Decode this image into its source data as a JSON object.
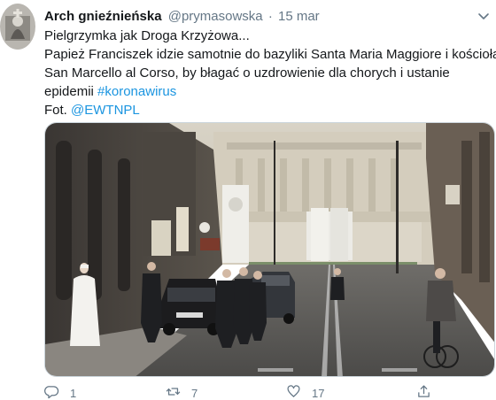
{
  "author": {
    "display_name": "Arch gnieźnieńska",
    "handle": "@prymasowska",
    "separator": "·",
    "timestamp": "15 mar"
  },
  "tweet": {
    "line1": "Pielgrzymka jak Droga Krzyżowa...",
    "line2": "Papież Franciszek idzie samotnie do bazyliki Santa Maria Maggiore i kościoła",
    "line3": "San Marcello al Corso, by błagać o uzdrowienie dla chorych i ustanie",
    "line4_text": "epidemii ",
    "hashtag": "#koronawirus",
    "line5_text": "Fot. ",
    "mention": "@EWTNPL"
  },
  "actions": {
    "reply_count": "1",
    "retweet_count": "7",
    "like_count": "17"
  },
  "icons": {
    "reply": "reply-icon",
    "retweet": "retweet-icon",
    "like": "heart-icon",
    "share": "share-icon",
    "menu": "chevron-down-icon"
  },
  "colors": {
    "link": "#1b95e0",
    "secondary_text": "#657786",
    "primary_text": "#14171a"
  }
}
